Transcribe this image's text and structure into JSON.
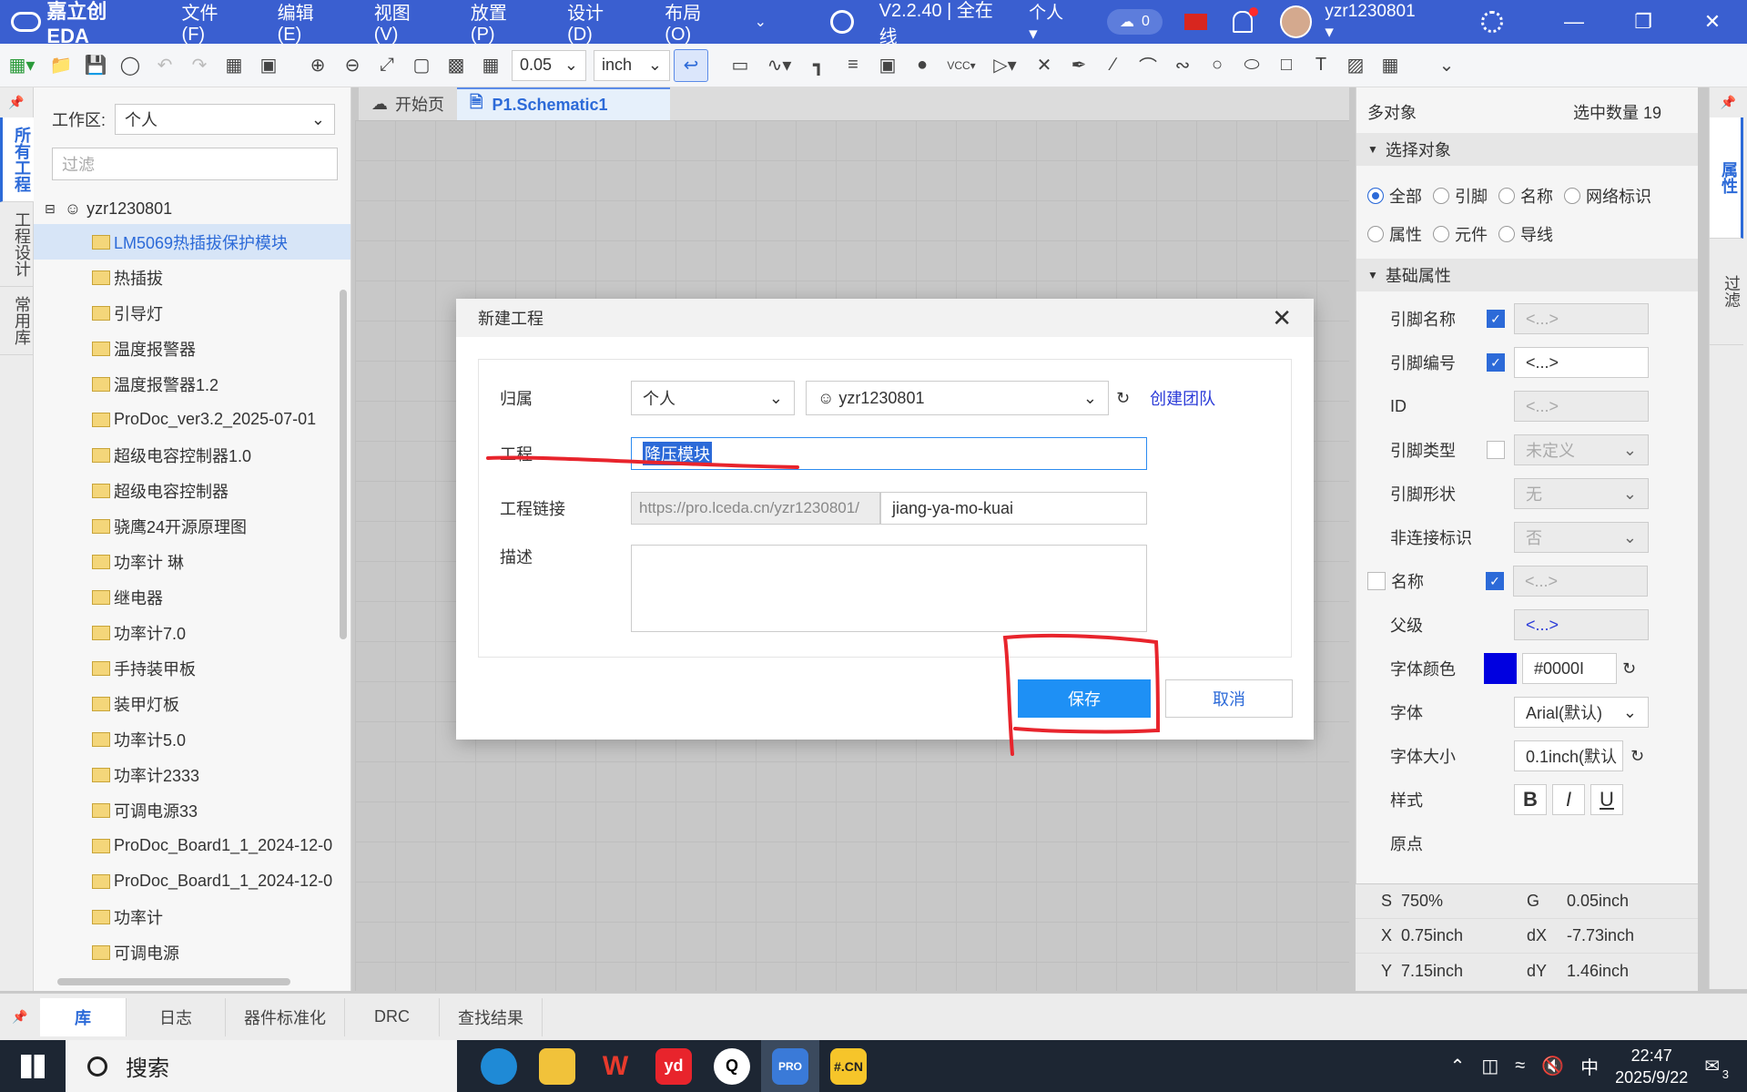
{
  "titlebar": {
    "logo_text": "嘉立创EDA",
    "menu": [
      "文件 (F)",
      "编辑 (E)",
      "视图 (V)",
      "放置 (P)",
      "设计 (D)",
      "布局 (O)"
    ],
    "version": "V2.2.40 | 全在线",
    "workspace": "个人",
    "cloud_count": "0",
    "username": "yzr1230801"
  },
  "toolbar": {
    "grid_value": "0.05",
    "unit_value": "inch"
  },
  "left_vtabs": [
    "所有工程",
    "工程设计",
    "常用库"
  ],
  "leftpanel": {
    "workspace_label": "工作区:",
    "workspace_value": "个人",
    "filter_placeholder": "过滤",
    "root_user": "yzr1230801",
    "projects": [
      "LM5069热插拔保护模块",
      "热插拔",
      "引导灯",
      "温度报警器",
      "温度报警器1.2",
      "ProDoc_ver3.2_2025-07-01",
      "超级电容控制器1.0",
      "超级电容控制器",
      "骁鹰24开源原理图",
      "功率计 琳",
      "继电器",
      "功率计7.0",
      "手持装甲板",
      "装甲灯板",
      "功率计5.0",
      "功率计2333",
      "可调电源33",
      "ProDoc_Board1_1_2024-12-0",
      "ProDoc_Board1_1_2024-12-0",
      "功率计",
      "可调电源"
    ]
  },
  "doc_tabs": [
    "开始页",
    "P1.Schematic1"
  ],
  "rightpanel": {
    "header_left": "多对象",
    "header_right": "选中数量  19",
    "section_select": "选择对象",
    "radios": [
      "全部",
      "引脚",
      "名称",
      "网络标识",
      "属性",
      "元件",
      "导线"
    ],
    "section_basic": "基础属性",
    "props": {
      "pin_name": {
        "label": "引脚名称",
        "value": "<...>"
      },
      "pin_number": {
        "label": "引脚编号",
        "value": "<...>"
      },
      "id": {
        "label": "ID",
        "value": "<...>"
      },
      "pin_type": {
        "label": "引脚类型",
        "value": "未定义"
      },
      "pin_shape": {
        "label": "引脚形状",
        "value": "无"
      },
      "no_connect": {
        "label": "非连接标识",
        "value": "否"
      },
      "name": {
        "label": "名称",
        "value": "<...>"
      },
      "parent": {
        "label": "父级",
        "value": "<...>"
      },
      "font_color": {
        "label": "字体颜色",
        "value": "#0000I"
      },
      "font": {
        "label": "字体",
        "value": "Arial(默认)"
      },
      "font_size": {
        "label": "字体大小",
        "value": "0.1inch(默认"
      },
      "style": {
        "label": "样式",
        "bold": "B",
        "italic": "I",
        "underline": "U"
      },
      "origin": {
        "label": "原点"
      }
    },
    "coords": {
      "s_label": "S",
      "s": "750%",
      "g_label": "G",
      "g": "0.05inch",
      "x_label": "X",
      "x": "0.75inch",
      "dx_label": "dX",
      "dx": "-7.73inch",
      "y_label": "Y",
      "y": "7.15inch",
      "dy_label": "dY",
      "dy": "1.46inch"
    }
  },
  "right_vtabs": [
    "属性",
    "过滤"
  ],
  "bottom_tabs": [
    "库",
    "日志",
    "器件标准化",
    "DRC",
    "查找结果"
  ],
  "modal": {
    "title": "新建工程",
    "owner_label": "归属",
    "owner_type": "个人",
    "owner_user": "yzr1230801",
    "create_team": "创建团队",
    "project_label": "工程",
    "project_value": "降压模块",
    "link_label": "工程链接",
    "link_prefix": "https://pro.lceda.cn/yzr1230801/",
    "link_value": "jiang-ya-mo-kuai",
    "desc_label": "描述",
    "save": "保存",
    "cancel": "取消"
  },
  "taskbar": {
    "search": "搜索",
    "ime": "中",
    "time": "22:47",
    "date": "2025/9/22",
    "notif_count": "3"
  },
  "colors": {
    "titlebar": "#3a5fd0",
    "accent": "#2c6ad8",
    "save_btn": "#1e90f5",
    "annotation": "#e8242c"
  }
}
